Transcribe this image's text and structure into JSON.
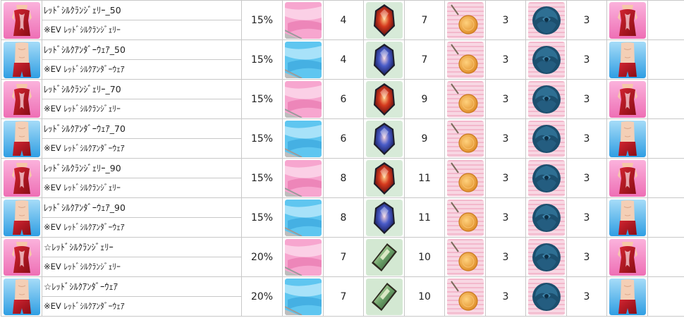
{
  "rows": [
    {
      "name": "ﾚｯﾄﾞｼﾙｸﾗﾝｼﾞｪﾘｰ_50",
      "sub": "※EV ﾚｯﾄﾞｼﾙｸﾗﾝｼﾞｪﾘｰ",
      "variant": "lingerie",
      "rate": "15%",
      "cloth": "pink",
      "cloth_qty": "4",
      "gem": "red",
      "gem_qty": "7",
      "badge_qty": "3",
      "rose_qty": "3"
    },
    {
      "name": "ﾚｯﾄﾞｼﾙｸｱﾝﾀﾞｰｳｪｱ_50",
      "sub": "※EV ﾚｯﾄﾞｼﾙｸｱﾝﾀﾞｰｳｪｱ",
      "variant": "underwear",
      "rate": "15%",
      "cloth": "blue",
      "cloth_qty": "4",
      "gem": "blue",
      "gem_qty": "7",
      "badge_qty": "3",
      "rose_qty": "3"
    },
    {
      "name": "ﾚｯﾄﾞｼﾙｸﾗﾝｼﾞｪﾘｰ_70",
      "sub": "※EV ﾚｯﾄﾞｼﾙｸﾗﾝｼﾞｪﾘｰ",
      "variant": "lingerie",
      "rate": "15%",
      "cloth": "pink",
      "cloth_qty": "6",
      "gem": "red",
      "gem_qty": "9",
      "badge_qty": "3",
      "rose_qty": "3"
    },
    {
      "name": "ﾚｯﾄﾞｼﾙｸｱﾝﾀﾞｰｳｪｱ_70",
      "sub": "※EV ﾚｯﾄﾞｼﾙｸｱﾝﾀﾞｰｳｪｱ",
      "variant": "underwear",
      "rate": "15%",
      "cloth": "blue",
      "cloth_qty": "6",
      "gem": "blue",
      "gem_qty": "9",
      "badge_qty": "3",
      "rose_qty": "3"
    },
    {
      "name": "ﾚｯﾄﾞｼﾙｸﾗﾝｼﾞｪﾘｰ_90",
      "sub": "※EV ﾚｯﾄﾞｼﾙｸﾗﾝｼﾞｪﾘｰ",
      "variant": "lingerie",
      "rate": "15%",
      "cloth": "pink",
      "cloth_qty": "8",
      "gem": "red",
      "gem_qty": "11",
      "badge_qty": "3",
      "rose_qty": "3"
    },
    {
      "name": "ﾚｯﾄﾞｼﾙｸｱﾝﾀﾞｰｳｪｱ_90",
      "sub": "※EV ﾚｯﾄﾞｼﾙｸｱﾝﾀﾞｰｳｪｱ",
      "variant": "underwear",
      "rate": "15%",
      "cloth": "blue",
      "cloth_qty": "8",
      "gem": "blue",
      "gem_qty": "11",
      "badge_qty": "3",
      "rose_qty": "3"
    },
    {
      "name": "☆ﾚｯﾄﾞｼﾙｸﾗﾝｼﾞｪﾘｰ",
      "sub": "※EV ﾚｯﾄﾞｼﾙｸﾗﾝｼﾞｪﾘｰ",
      "variant": "lingerie",
      "rate": "20%",
      "cloth": "pink",
      "cloth_qty": "7",
      "gem": "green",
      "gem_qty": "10",
      "badge_qty": "3",
      "rose_qty": "3"
    },
    {
      "name": "☆ﾚｯﾄﾞｼﾙｸｱﾝﾀﾞｰｳｪｱ",
      "sub": "※EV ﾚｯﾄﾞｼﾙｸｱﾝﾀﾞｰｳｪｱ",
      "variant": "underwear",
      "rate": "20%",
      "cloth": "blue",
      "cloth_qty": "7",
      "gem": "green",
      "gem_qty": "10",
      "badge_qty": "3",
      "rose_qty": "3"
    }
  ],
  "icons": {
    "lingerie": "lingerie-icon",
    "underwear": "underwear-icon",
    "cloth": "silk-cloth-icon",
    "gem": "gem-icon",
    "badge": "badge-icon",
    "rose": "blue-rose-icon"
  },
  "colors": {
    "pink_bg": "#f78fc6",
    "blue_bg": "#44b4ee",
    "red_item": "#b3151c",
    "pink_cloth": "#f58cbf",
    "blue_cloth": "#53c4ee",
    "red_gem": "#a3121a",
    "blue_gem": "#2a3aa0",
    "green_gem": "#6aa168",
    "badge_gold": "#f4a63c",
    "rose_blue": "#1c4f6e"
  }
}
